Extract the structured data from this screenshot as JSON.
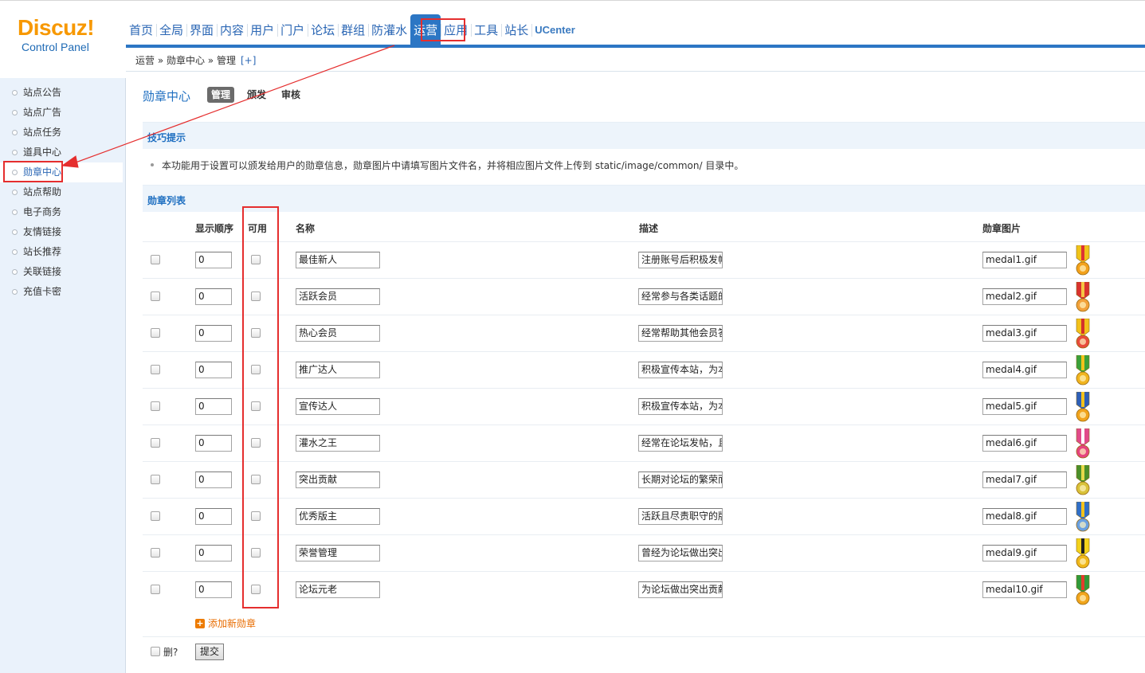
{
  "logo": {
    "main": "Discuz!",
    "sub": "Control Panel"
  },
  "nav": [
    "首页",
    "全局",
    "界面",
    "内容",
    "用户",
    "门户",
    "论坛",
    "群组",
    "防灌水",
    "运营",
    "应用",
    "工具",
    "站长",
    "UCenter"
  ],
  "nav_active": "运营",
  "breadcrumb": {
    "text": "运营 » 勋章中心 » 管理",
    "plus": "[+]"
  },
  "sidebar": [
    "站点公告",
    "站点广告",
    "站点任务",
    "道具中心",
    "勋章中心",
    "站点帮助",
    "电子商务",
    "友情链接",
    "站长推荐",
    "关联链接",
    "充值卡密"
  ],
  "sidebar_active": "勋章中心",
  "page": {
    "title": "勋章中心",
    "tabs": [
      "管理",
      "颁发",
      "审核"
    ],
    "tip_title": "技巧提示",
    "tip_text": "本功能用于设置可以颁发给用户的勋章信息，勋章图片中请填写图片文件名，并将相应图片文件上传到 static/image/common/ 目录中。",
    "list_title": "勋章列表"
  },
  "table": {
    "headers": [
      "显示顺序",
      "可用",
      "名称",
      "描述",
      "勋章图片"
    ],
    "rows": [
      {
        "order": "0",
        "name": "最佳新人",
        "desc": "注册账号后积极发帖",
        "image": "medal1.gif",
        "ribbon": "#f0c419",
        "stripe": "#d33",
        "body": "#f3a21c"
      },
      {
        "order": "0",
        "name": "活跃会员",
        "desc": "经常参与各类话题的",
        "image": "medal2.gif",
        "ribbon": "#d9322e",
        "stripe": "#f4c542",
        "body": "#f2a13a"
      },
      {
        "order": "0",
        "name": "热心会员",
        "desc": "经常帮助其他会员答",
        "image": "medal3.gif",
        "ribbon": "#f3c21a",
        "stripe": "#d4322b",
        "body": "#e84b3c"
      },
      {
        "order": "0",
        "name": "推广达人",
        "desc": "积极宣传本站，为本",
        "image": "medal4.gif",
        "ribbon": "#3aa13a",
        "stripe": "#f2c21b",
        "body": "#f1b520"
      },
      {
        "order": "0",
        "name": "宣传达人",
        "desc": "积极宣传本站，为本",
        "image": "medal5.gif",
        "ribbon": "#2d5fb8",
        "stripe": "#f2c21b",
        "body": "#f1a31c"
      },
      {
        "order": "0",
        "name": "灌水之王",
        "desc": "经常在论坛发帖，且",
        "image": "medal6.gif",
        "ribbon": "#e14a8a",
        "stripe": "#ffffff",
        "body": "#e5447f"
      },
      {
        "order": "0",
        "name": "突出贡献",
        "desc": "长期对论坛的繁荣而",
        "image": "medal7.gif",
        "ribbon": "#4a8f2a",
        "stripe": "#e6d84a",
        "body": "#d9c23a"
      },
      {
        "order": "0",
        "name": "优秀版主",
        "desc": "活跃且尽责职守的版",
        "image": "medal8.gif",
        "ribbon": "#2f6fc9",
        "stripe": "#f3c21b",
        "body": "#6aa0e0"
      },
      {
        "order": "0",
        "name": "荣誉管理",
        "desc": "曾经为论坛做出突出",
        "image": "medal9.gif",
        "ribbon": "#f3d21b",
        "stripe": "#222222",
        "body": "#f0b81a"
      },
      {
        "order": "0",
        "name": "论坛元老",
        "desc": "为论坛做出突出贡献",
        "image": "medal10.gif",
        "ribbon": "#2f9a3a",
        "stripe": "#e23c2c",
        "body": "#f1a51c"
      }
    ]
  },
  "footer": {
    "add_label": "添加新勋章",
    "delete_label": "删?",
    "submit_label": "提交"
  },
  "colors": {
    "accent": "#2c76c4",
    "annotation": "#e52e2e",
    "logo": "#f79800",
    "link": "#1f6fc1"
  }
}
